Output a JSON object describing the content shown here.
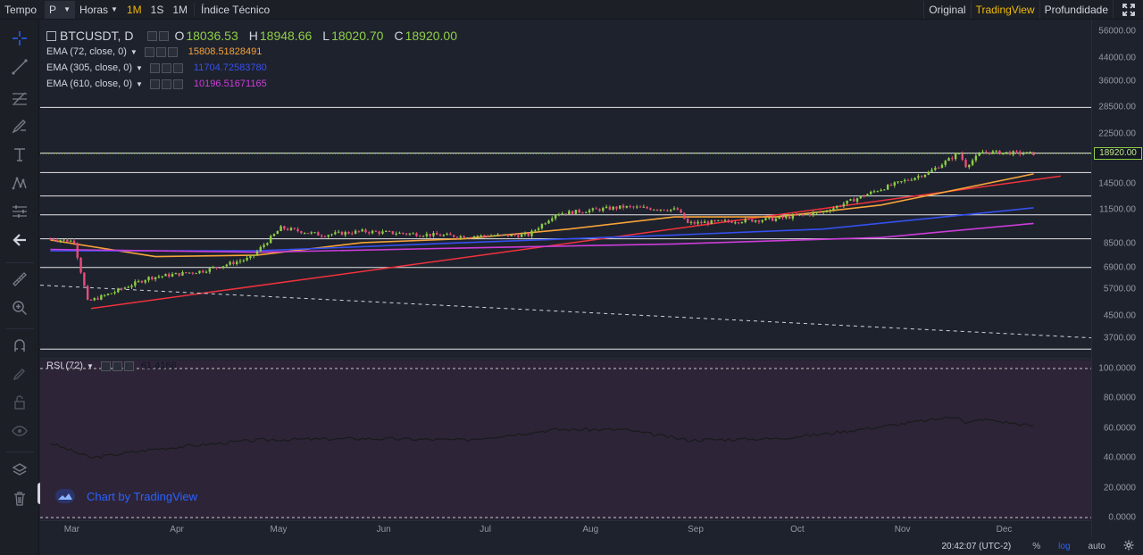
{
  "toolbar": {
    "tempo_label": "Tempo",
    "chart_type_value": "P",
    "interval_unit_label": "Horas",
    "intervals": [
      "1M",
      "1S",
      "1M"
    ],
    "active_interval_index": 0,
    "indicators_label": "Índice Técnico",
    "views": [
      "Original",
      "TradingView",
      "Profundidade"
    ],
    "active_view_index": 1
  },
  "legend": {
    "symbol": "BTCUSDT, D",
    "open_label": "O",
    "open_value": "18036.53",
    "high_label": "H",
    "high_value": "18948.66",
    "low_label": "L",
    "low_value": "18020.70",
    "close_label": "C",
    "close_value": "18920.00"
  },
  "indicators": [
    {
      "label": "EMA (72, close, 0)",
      "value": "15808.51828491",
      "color": "#f7a33a"
    },
    {
      "label": "EMA (305, close, 0)",
      "value": "11704.72583780",
      "color": "#3550f0"
    },
    {
      "label": "EMA (610, close, 0)",
      "value": "10196.51671165",
      "color": "#cc3dd9"
    }
  ],
  "rsi": {
    "label": "RSI (72)",
    "value": "61.4168",
    "color": "#1b1b1b"
  },
  "watermark": "Chart by TradingView",
  "colors": {
    "background": "#1e222d",
    "rsi_background": "#2d2438",
    "up_candle": "#8fce46",
    "down_candle": "#e84c7b",
    "trendline": "#f0323c",
    "horizontal_levels": "#e6e6e6",
    "accent": "#f0b90b",
    "link": "#2962ff"
  },
  "price_axis": {
    "ticks": [
      "56000.00",
      "44000.00",
      "36000.00",
      "28500.00",
      "22500.00",
      "14500.00",
      "11500.00",
      "8500.00",
      "6900.00",
      "5700.00",
      "4500.00",
      "3700.00"
    ],
    "last_price": "18920.00"
  },
  "rsi_axis": {
    "ticks": [
      "100.0000",
      "80.0000",
      "60.0000",
      "40.0000",
      "20.0000",
      "0.0000"
    ]
  },
  "time_axis": {
    "ticks": [
      "Mar",
      "Apr",
      "May",
      "Jun",
      "Jul",
      "Aug",
      "Sep",
      "Oct",
      "Nov",
      "Dec"
    ]
  },
  "status": {
    "clock": "20:42:07 (UTC-2)",
    "percent": "%",
    "log": "log",
    "auto": "auto",
    "log_active": true
  },
  "chart_data": {
    "type": "candlestick",
    "scale": "log",
    "grid": false,
    "ylim": [
      3200,
      62000
    ],
    "horizontal_levels": [
      28500,
      19000,
      16000,
      13000,
      11000,
      8900,
      6900,
      3350
    ],
    "trendlines": [
      {
        "name": "support",
        "from": [
          "2020-03-13",
          4800
        ],
        "to": [
          "2020-12-24",
          15500
        ],
        "style": "solid"
      },
      {
        "name": "resistance",
        "from": [
          "2020-02-27",
          5900
        ],
        "to": [
          "2021-01-02",
          3700
        ],
        "style": "dashed"
      }
    ],
    "ema_series": [
      {
        "name": "EMA (72, close, 0)",
        "points": [
          [
            "2020-03-01",
            8800
          ],
          [
            "2020-04-01",
            7600
          ],
          [
            "2020-05-01",
            7700
          ],
          [
            "2020-06-01",
            8600
          ],
          [
            "2020-07-01",
            8900
          ],
          [
            "2020-08-01",
            9700
          ],
          [
            "2020-09-01",
            10800
          ],
          [
            "2020-10-01",
            10800
          ],
          [
            "2020-11-01",
            12000
          ],
          [
            "2020-12-16",
            15808
          ]
        ]
      },
      {
        "name": "EMA (305, close, 0)",
        "points": [
          [
            "2020-03-01",
            8000
          ],
          [
            "2020-05-01",
            8000
          ],
          [
            "2020-07-01",
            8600
          ],
          [
            "2020-09-01",
            9200
          ],
          [
            "2020-10-15",
            9700
          ],
          [
            "2020-12-16",
            11704
          ]
        ]
      },
      {
        "name": "EMA (610, close, 0)",
        "points": [
          [
            "2020-03-01",
            8100
          ],
          [
            "2020-05-01",
            7900
          ],
          [
            "2020-07-01",
            8200
          ],
          [
            "2020-09-01",
            8500
          ],
          [
            "2020-11-01",
            9000
          ],
          [
            "2020-12-16",
            10196
          ]
        ]
      }
    ],
    "price_path": [
      [
        "2020-03-01",
        8900
      ],
      [
        "2020-03-08",
        8700
      ],
      [
        "2020-03-12",
        5100
      ],
      [
        "2020-03-19",
        5500
      ],
      [
        "2020-03-30",
        6300
      ],
      [
        "2020-04-15",
        6700
      ],
      [
        "2020-04-29",
        7500
      ],
      [
        "2020-05-08",
        9800
      ],
      [
        "2020-05-20",
        9200
      ],
      [
        "2020-06-01",
        9500
      ],
      [
        "2020-06-30",
        9100
      ],
      [
        "2020-07-20",
        9200
      ],
      [
        "2020-07-28",
        11100
      ],
      [
        "2020-08-17",
        11800
      ],
      [
        "2020-09-02",
        11500
      ],
      [
        "2020-09-05",
        10200
      ],
      [
        "2020-10-01",
        10600
      ],
      [
        "2020-10-15",
        11300
      ],
      [
        "2020-10-31",
        13700
      ],
      [
        "2020-11-15",
        16000
      ],
      [
        "2020-11-24",
        19000
      ],
      [
        "2020-11-26",
        17000
      ],
      [
        "2020-12-01",
        19200
      ],
      [
        "2020-12-16",
        18920
      ]
    ],
    "rsi_path": [
      [
        "2020-03-01",
        50
      ],
      [
        "2020-03-13",
        40
      ],
      [
        "2020-04-01",
        46
      ],
      [
        "2020-05-01",
        52
      ],
      [
        "2020-06-01",
        53
      ],
      [
        "2020-07-01",
        52
      ],
      [
        "2020-07-28",
        59
      ],
      [
        "2020-08-17",
        59
      ],
      [
        "2020-09-05",
        52
      ],
      [
        "2020-10-01",
        53
      ],
      [
        "2020-10-15",
        56
      ],
      [
        "2020-11-01",
        61
      ],
      [
        "2020-11-24",
        68
      ],
      [
        "2020-11-26",
        63
      ],
      [
        "2020-12-01",
        66
      ],
      [
        "2020-12-16",
        61.4168
      ]
    ],
    "rsi_range": [
      0,
      100
    ]
  }
}
